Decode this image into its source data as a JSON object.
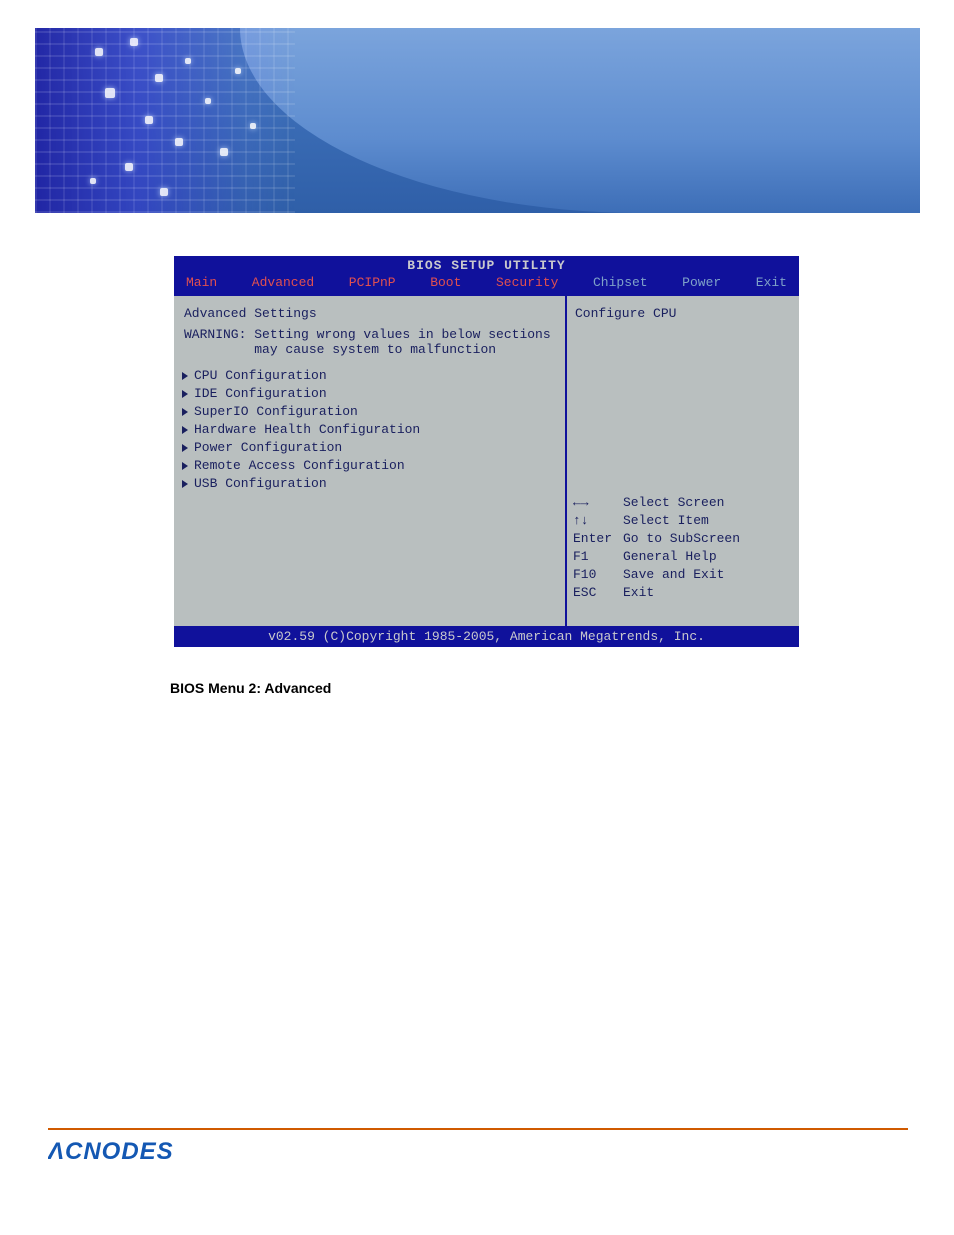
{
  "bios": {
    "title": "BIOS SETUP UTILITY",
    "tabs": [
      "Main",
      "Advanced",
      "PCIPnP",
      "Boot",
      "Security",
      "Chipset",
      "Power",
      "Exit"
    ],
    "tabs_dim_from_index": 5,
    "section_heading": "Advanced Settings",
    "warning_line1": "WARNING: Setting wrong values in below sections",
    "warning_line2": "         may cause system to malfunction",
    "items": [
      "CPU Configuration",
      "IDE Configuration",
      "SuperIO Configuration",
      "Hardware Health Configuration",
      "Power Configuration",
      "Remote Access Configuration",
      "USB Configuration"
    ],
    "right_hint": "Configure CPU",
    "help": [
      {
        "key": "←→",
        "desc": "Select Screen"
      },
      {
        "key": "↑↓",
        "desc": "Select Item"
      },
      {
        "key": "Enter",
        "desc": "Go to SubScreen"
      },
      {
        "key": "F1",
        "desc": "General Help"
      },
      {
        "key": "F10",
        "desc": "Save and Exit"
      },
      {
        "key": "ESC",
        "desc": "Exit"
      }
    ],
    "footer": "v02.59 (C)Copyright 1985-2005, American Megatrends, Inc."
  },
  "caption": "BIOS Menu 2: Advanced",
  "brand": "ACNODES"
}
